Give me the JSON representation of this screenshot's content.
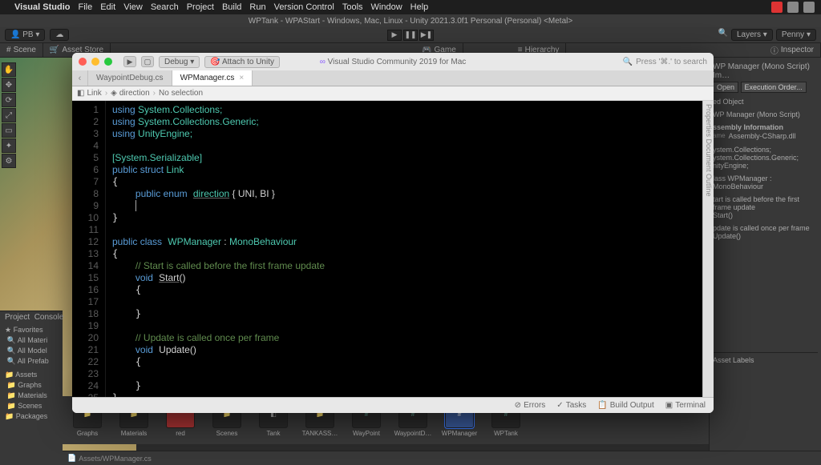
{
  "mac_menu": {
    "app": "Visual Studio",
    "items": [
      "File",
      "Edit",
      "View",
      "Search",
      "Project",
      "Build",
      "Run",
      "Version Control",
      "Tools",
      "Window",
      "Help"
    ]
  },
  "unity": {
    "title": "WPTank - WPAStart - Windows, Mac, Linux - Unity 2021.3.0f1 Personal (Personal) <Metal>",
    "account": "PB",
    "cloud": "",
    "layers": "Layers",
    "layout": "Penny",
    "tabs": {
      "scene": "Scene",
      "asset_store": "Asset Store",
      "game": "Game",
      "hierarchy": "Hierarchy",
      "inspector": "Inspector"
    },
    "project_tab": "Project",
    "console_tab": "Console",
    "favorites_label": "Favorites",
    "assets_label": "Assets",
    "fav_items": [
      "All Materi",
      "All Model",
      "All Prefab"
    ],
    "asset_tree": [
      "Graphs",
      "Materials",
      "Scenes",
      "Packages"
    ],
    "assets_header": "Assets",
    "thumbs": [
      "Graphs",
      "Materials",
      "red",
      "Scenes",
      "Tank",
      "TANKASS…",
      "WayPoint",
      "WaypointD…",
      "WPManager",
      "WPTank"
    ],
    "selected_thumb": 8,
    "footer_path": "Assets/WPManager.cs"
  },
  "inspector": {
    "header": "WP Manager (Mono Script) Im…",
    "open_btn": "Open",
    "exec_btn": "Execution Order...",
    "import_obj": "ed Object",
    "script_line": "WP Manager (Mono Script)",
    "assembly_hdr": "ssembly Information",
    "name_label": "ame",
    "name_value": "Assembly-CSharp.dll",
    "refs": [
      "ystem.Collections;",
      "ystem.Collections.Generic;",
      "nityEngine;"
    ],
    "class_line": "lass WPManager : MonoBehaviour",
    "start_cmt": "tart is called before the first frame update",
    "start_fn": "Start()",
    "upd_cmt": "pdate is called once per frame",
    "upd_fn": "Update()",
    "labels_hdr": "Asset Labels"
  },
  "vs": {
    "title": "Visual Studio Community 2019 for Mac",
    "debug_dd": "Debug",
    "attach": "Attach to Unity",
    "search_placeholder": "Press '⌘.' to search",
    "tabs": [
      {
        "label": "WaypointDebug.cs",
        "active": false
      },
      {
        "label": "WPManager.cs",
        "active": true
      }
    ],
    "crumb": [
      "Link",
      "direction",
      "No selection"
    ],
    "status": {
      "errors": "Errors",
      "tasks": "Tasks",
      "build": "Build Output",
      "terminal": "Terminal"
    },
    "side_tabs": "Properties  Document Outline",
    "code": {
      "lines": 26,
      "l1": {
        "kw": "using",
        "t": " System.Collections;"
      },
      "l2": {
        "kw": "using",
        "t": " System.Collections.Generic;"
      },
      "l3": {
        "kw": "using",
        "t": " UnityEngine;"
      },
      "l5": "[System.Serializable]",
      "l6": {
        "kw": "public struct",
        "t": " Link"
      },
      "l8_a": "public enum",
      "l8_b": "direction",
      "l8_c": " { UNI, BI }",
      "l12": {
        "kw": "public class",
        "ty": "WPManager",
        "rest": " : ",
        "base": "MonoBehaviour"
      },
      "l14": "// Start is called before the first frame update",
      "l15_kw": "void",
      "l15_fn": "Start",
      "l15_p": "()",
      "l20": "// Update is called once per frame",
      "l21_kw": "void",
      "l21_fn": "Update",
      "l21_p": "()"
    }
  }
}
